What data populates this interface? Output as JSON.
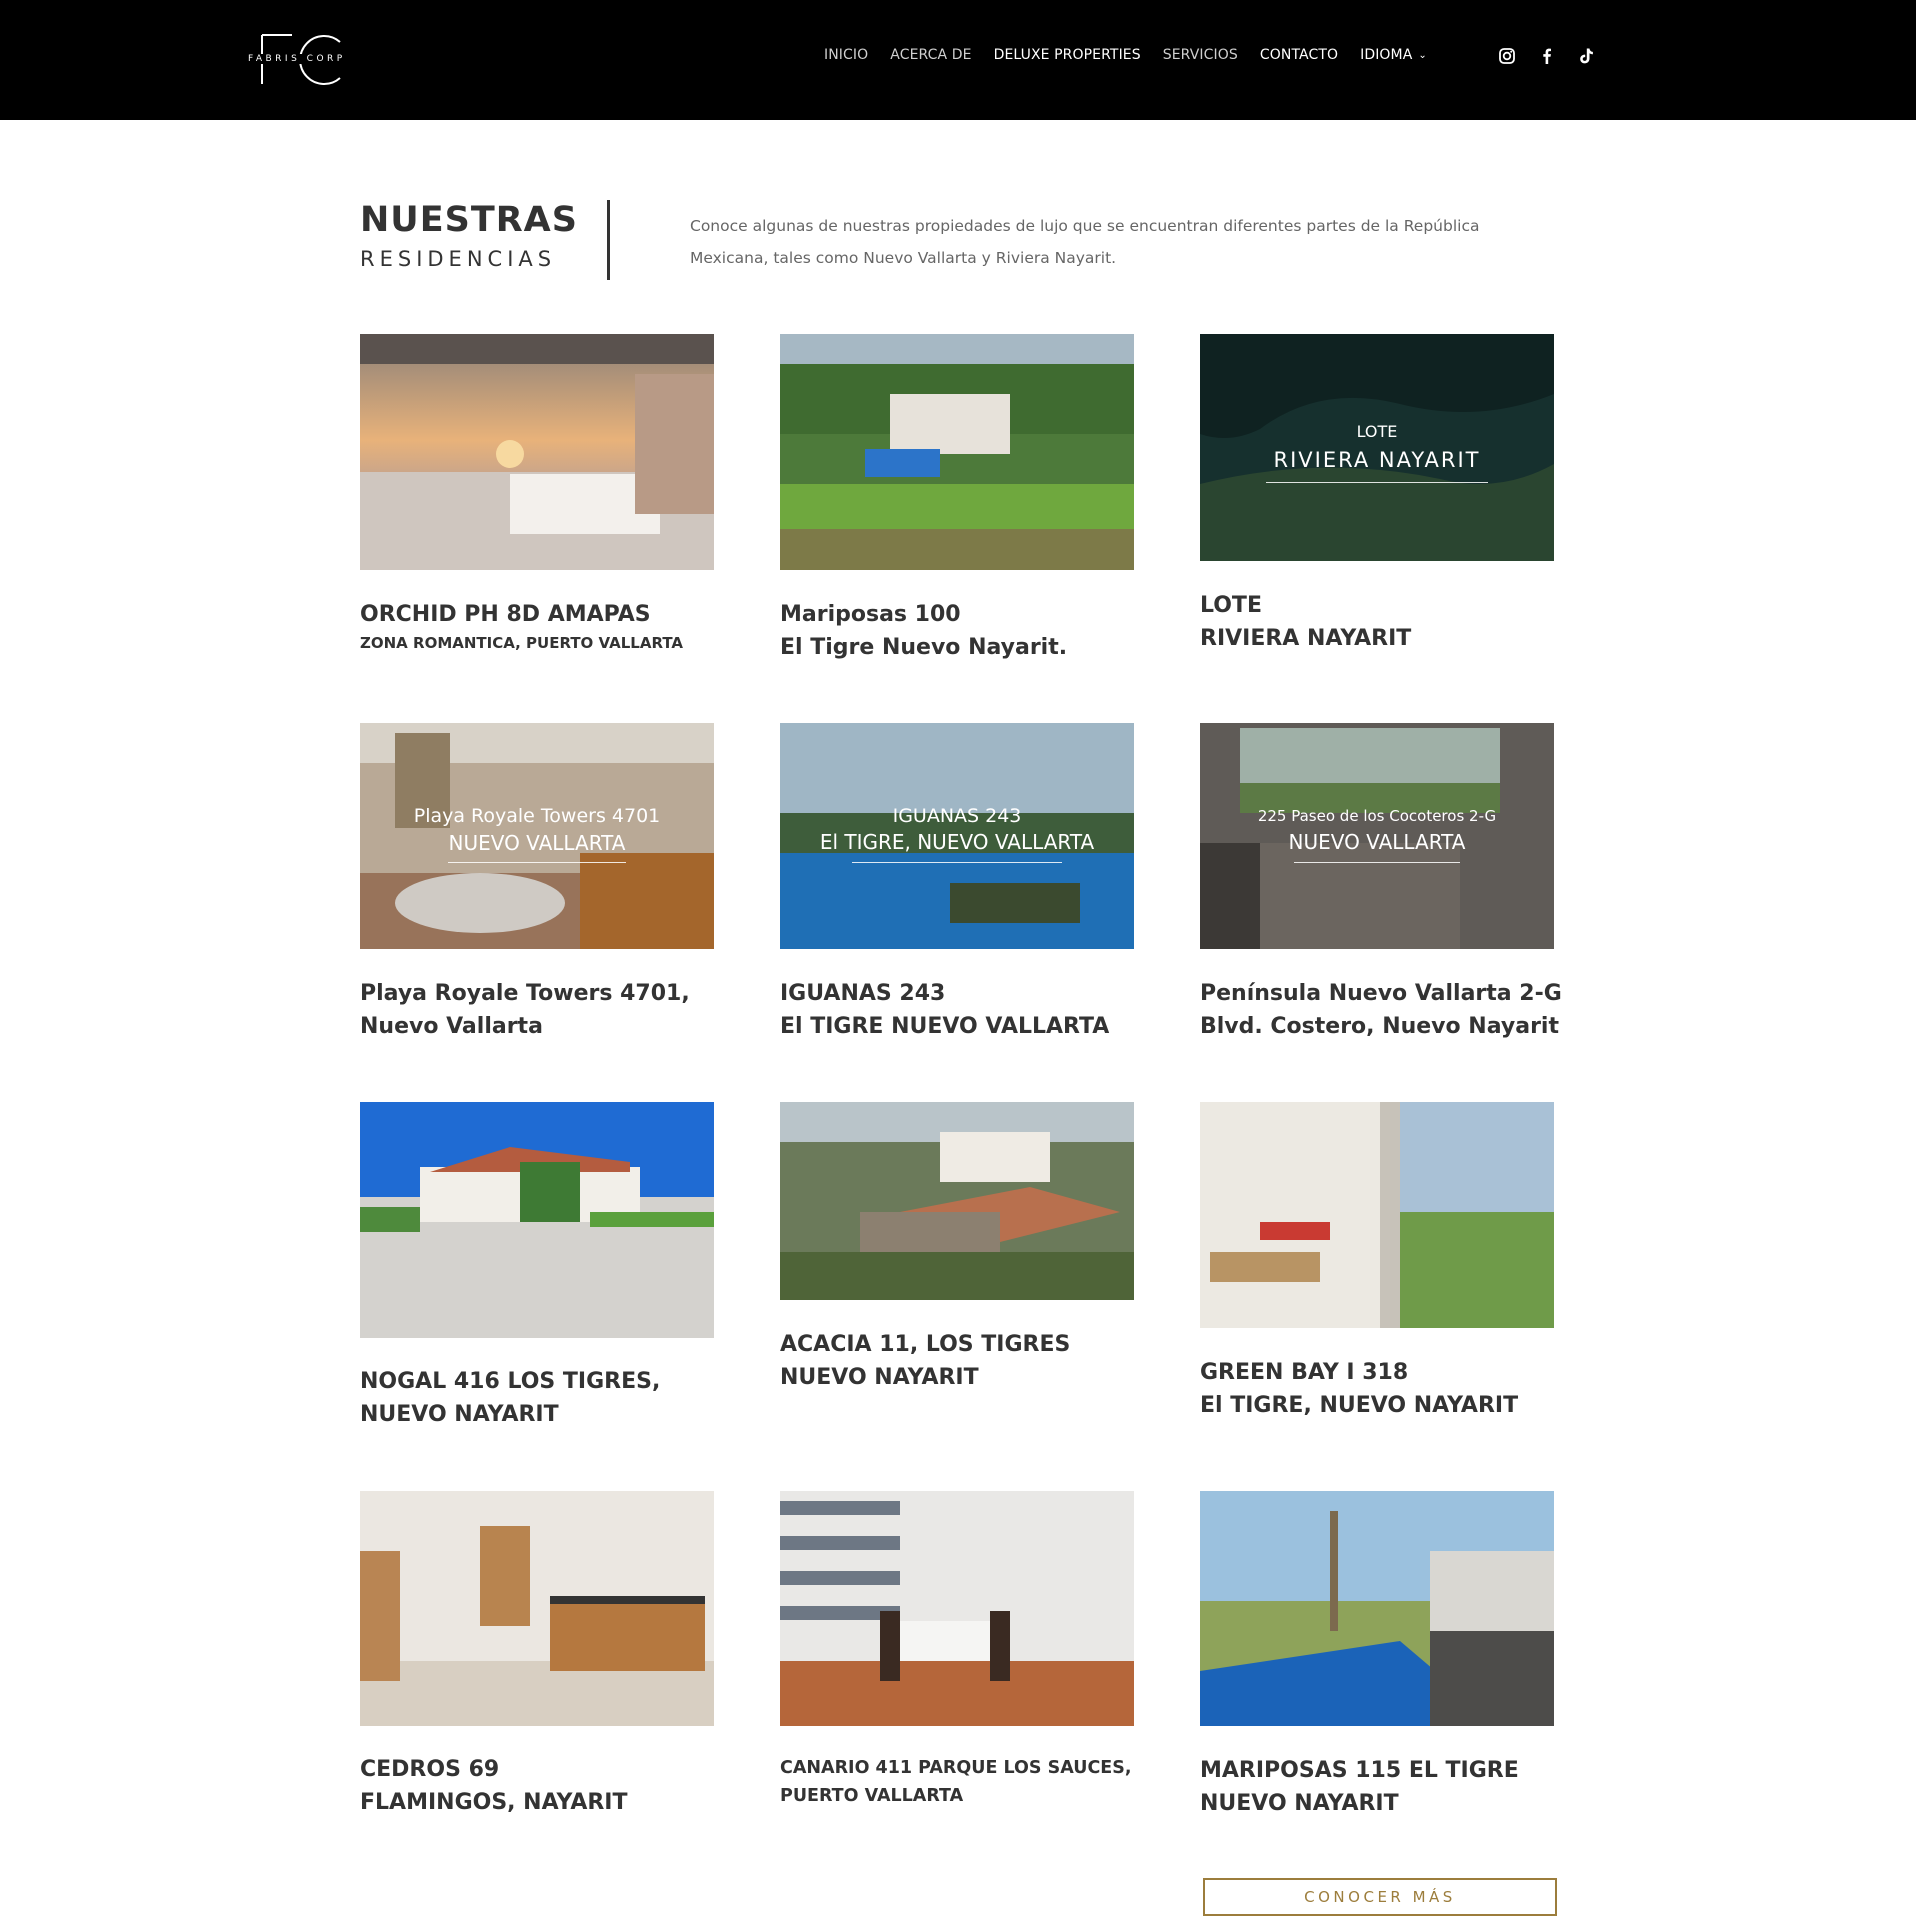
{
  "header": {
    "logo_letters": "FC",
    "logo_text": "FABRIS CORP",
    "nav": [
      {
        "label": "INICIO",
        "active": false
      },
      {
        "label": "ACERCA DE",
        "active": false
      },
      {
        "label": "DELUXE PROPERTIES",
        "active": true
      },
      {
        "label": "SERVICIOS",
        "active": false
      },
      {
        "label": "CONTACTO",
        "active": true
      },
      {
        "label": "IDIOMA",
        "active": true
      }
    ],
    "social": [
      "instagram-icon",
      "facebook-icon",
      "tiktok-icon"
    ]
  },
  "intro": {
    "title": "NUESTRAS",
    "subtitle": "RESIDENCIAS",
    "description": "Conoce algunas de nuestras propiedades de lujo que se encuentran diferentes partes de la República Mexicana, tales como Nuevo Vallarta y Riviera Nayarit."
  },
  "properties": [
    {
      "title": "ORCHID PH 8D AMAPAS",
      "sub": "ZONA ROMANTICA,  PUERTO VALLARTA"
    },
    {
      "title": "Mariposas 100",
      "sub": "El Tigre Nuevo Nayarit."
    },
    {
      "title": "LOTE",
      "sub": "RIVIERA NAYARIT",
      "overlay_top": "LOTE",
      "overlay_main": "RIVIERA NAYARIT"
    },
    {
      "title": "Playa Royale Towers 4701,",
      "sub": "Nuevo Vallarta",
      "overlay_top": "Playa Royale Towers 4701",
      "overlay_main": "NUEVO VALLARTA"
    },
    {
      "title": "IGUANAS 243",
      "sub": "El TIGRE NUEVO VALLARTA",
      "overlay_top": "IGUANAS 243",
      "overlay_main": "El TIGRE, NUEVO VALLARTA"
    },
    {
      "title": "Península Nuevo Vallarta 2-G",
      "sub": "Blvd. Costero, Nuevo Nayarit",
      "overlay_top": "225 Paseo de los Cocoteros 2-G",
      "overlay_main": "NUEVO VALLARTA"
    },
    {
      "title": "NOGAL 416 LOS TIGRES,",
      "sub": "NUEVO NAYARIT"
    },
    {
      "title": "ACACIA 11, LOS TIGRES",
      "sub": "NUEVO NAYARIT"
    },
    {
      "title": "GREEN BAY I 318",
      "sub": "El TIGRE, NUEVO NAYARIT"
    },
    {
      "title": "CEDROS 69",
      "sub": "FLAMINGOS, NAYARIT"
    },
    {
      "title": "CANARIO 411 PARQUE LOS SAUCES,",
      "sub": "PUERTO VALLARTA"
    },
    {
      "title": "MARIPOSAS 115 EL TIGRE",
      "sub": "NUEVO NAYARIT"
    }
  ],
  "cta": {
    "label": "CONOCER MÁS"
  }
}
